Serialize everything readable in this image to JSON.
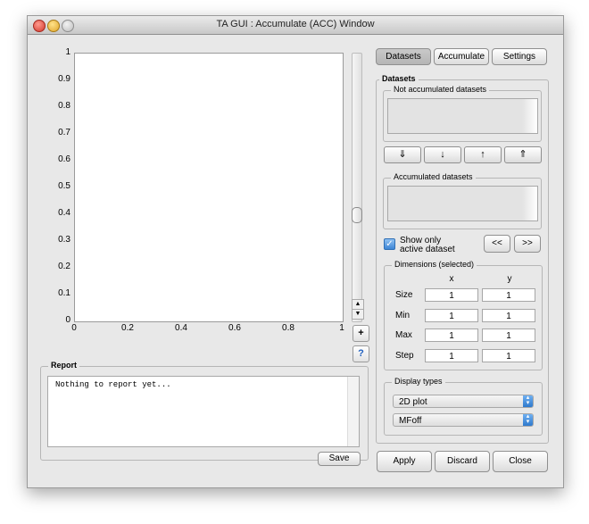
{
  "window": {
    "title": "TA GUI : Accumulate (ACC) Window"
  },
  "plot": {
    "y_ticks": [
      "1",
      "0.9",
      "0.8",
      "0.7",
      "0.6",
      "0.5",
      "0.4",
      "0.3",
      "0.2",
      "0.1",
      "0"
    ],
    "x_ticks": [
      "0",
      "0.2",
      "0.4",
      "0.6",
      "0.8",
      "1"
    ],
    "zoom_label": "+",
    "help_label": "?"
  },
  "report": {
    "title": "Report",
    "text": "Nothing to report yet...",
    "save_label": "Save"
  },
  "tabs": {
    "datasets": "Datasets",
    "accumulate": "Accumulate",
    "settings": "Settings"
  },
  "datasets_panel": {
    "title": "Datasets",
    "not_accumulated_label": "Not accumulated datasets",
    "accumulated_label": "Accumulated datasets",
    "move_buttons": [
      "⇓",
      "↓",
      "↑",
      "⇑"
    ],
    "show_only_label_line1": "Show only",
    "show_only_label_line2": "active dataset",
    "show_only_checked": true,
    "prev_label": "<<",
    "next_label": ">>"
  },
  "dimensions": {
    "title": "Dimensions (selected)",
    "col_x": "x",
    "col_y": "y",
    "rows": [
      {
        "label": "Size",
        "x": "1",
        "y": "1"
      },
      {
        "label": "Min",
        "x": "1",
        "y": "1"
      },
      {
        "label": "Max",
        "x": "1",
        "y": "1"
      },
      {
        "label": "Step",
        "x": "1",
        "y": "1"
      }
    ]
  },
  "display_types": {
    "title": "Display types",
    "type_value": "2D plot",
    "mode_value": "MFoff"
  },
  "footer": {
    "apply": "Apply",
    "discard": "Discard",
    "close": "Close"
  },
  "colors": {
    "window_bg": "#e8e8e8",
    "accent": "#3d86d6"
  }
}
